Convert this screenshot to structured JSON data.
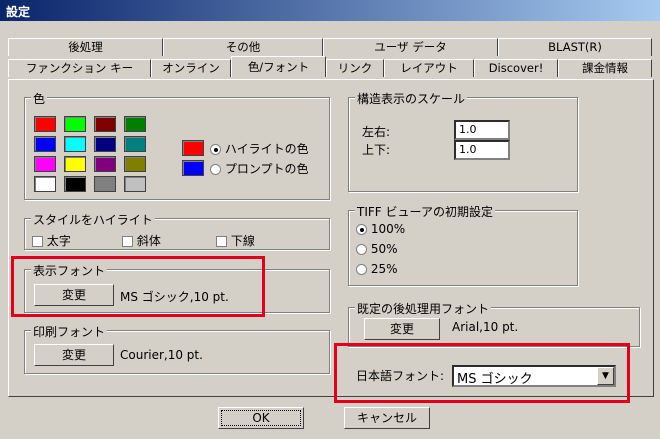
{
  "window": {
    "title": "設定"
  },
  "tabs": {
    "row1": [
      "後処理",
      "その他",
      "ユーザ データ",
      "BLAST(R)"
    ],
    "row2": [
      "ファンクション キー",
      "オンライン",
      "色/フォント",
      "リンク",
      "レイアウト",
      "Discover!",
      "課金情報"
    ]
  },
  "color_group": {
    "title": "色",
    "highlight_label": "ハイライトの色",
    "prompt_label": "プロンプトの色",
    "swatches": [
      "#ff0000",
      "#00ff00",
      "#800000",
      "#008000",
      "#0000ff",
      "#00ffff",
      "#000080",
      "#008080",
      "#ff00ff",
      "#ffff00",
      "#800080",
      "#808000",
      "#ffffff",
      "#000000",
      "#808080",
      "#c0c0c0"
    ],
    "highlight_color": "#ff0000",
    "prompt_color": "#0000ff"
  },
  "scale_group": {
    "title": "構造表示のスケール",
    "lr_label": "左右:",
    "lr_value": "1.0",
    "ud_label": "上下:",
    "ud_value": "1.0"
  },
  "style_group": {
    "title": "スタイルをハイライト",
    "bold": "太字",
    "italic": "斜体",
    "underline": "下線"
  },
  "tiff_group": {
    "title": "TIFF ビューアの初期設定",
    "options": [
      "100%",
      "50%",
      "25%"
    ]
  },
  "display_font": {
    "title": "表示フォント",
    "button": "変更",
    "value": "MS ゴシック,10 pt."
  },
  "print_font": {
    "title": "印刷フォント",
    "button": "変更",
    "value": "Courier,10 pt."
  },
  "post_font": {
    "title": "既定の後処理用フォント",
    "button": "変更",
    "value": "Arial,10 pt."
  },
  "japanese_font": {
    "label": "日本語フォント:",
    "value": "MS ゴシック",
    "arrow": "▼"
  },
  "buttons": {
    "ok": "OK",
    "cancel": "キャンセル"
  }
}
